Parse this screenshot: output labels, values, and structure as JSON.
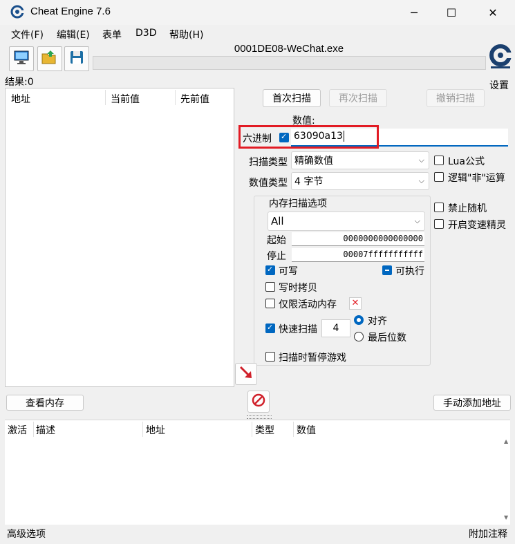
{
  "window": {
    "title": "Cheat Engine 7.6",
    "minimize_glyph": "─",
    "maximize_glyph": "☐",
    "close_glyph": "✕"
  },
  "menu": [
    "文件(F)",
    "编辑(E)",
    "表单",
    "D3D",
    "帮助(H)"
  ],
  "toolbar": {
    "process_name": "0001DE08-WeChat.exe",
    "settings_label": "设置"
  },
  "results": {
    "label": "结果:0",
    "columns": [
      "地址",
      "当前值",
      "先前值"
    ]
  },
  "scan": {
    "first_scan": "首次扫描",
    "next_scan": "再次扫描",
    "undo_scan": "撤销扫描",
    "value_label": "数值:",
    "hex_label": "六进制",
    "hex_checked": true,
    "value_input": "63090a13",
    "scan_type_label": "扫描类型",
    "scan_type_value": "精确数值",
    "value_type_label": "数值类型",
    "value_type_value": "4 字节",
    "lua_formula": "Lua公式",
    "logical_not": "逻辑\"非\"运算",
    "disable_random": "禁止随机",
    "speedhack": "开启变速精灵"
  },
  "memory_options": {
    "group_title": "内存扫描选项",
    "region": "All",
    "start_label": "起始",
    "start_value": "0000000000000000",
    "stop_label": "停止",
    "stop_value": "00007fffffffffff",
    "writable": "可写",
    "executable": "可执行",
    "copy_on_write": "写时拷贝",
    "active_memory_only": "仅限活动内存",
    "fast_scan": "快速扫描",
    "fast_scan_value": "4",
    "align": "对齐",
    "last_digits": "最后位数",
    "pause_game": "扫描时暂停游戏"
  },
  "bottom": {
    "view_memory": "查看内存",
    "add_address": "手动添加地址",
    "list_columns": [
      "激活",
      "描述",
      "地址",
      "类型",
      "数值"
    ],
    "advanced_options": "高级选项",
    "add_comment": "附加注释"
  },
  "colors": {
    "accent": "#0067c0",
    "highlight_box": "#e21b24",
    "window_bg": "#f0f0f0"
  }
}
